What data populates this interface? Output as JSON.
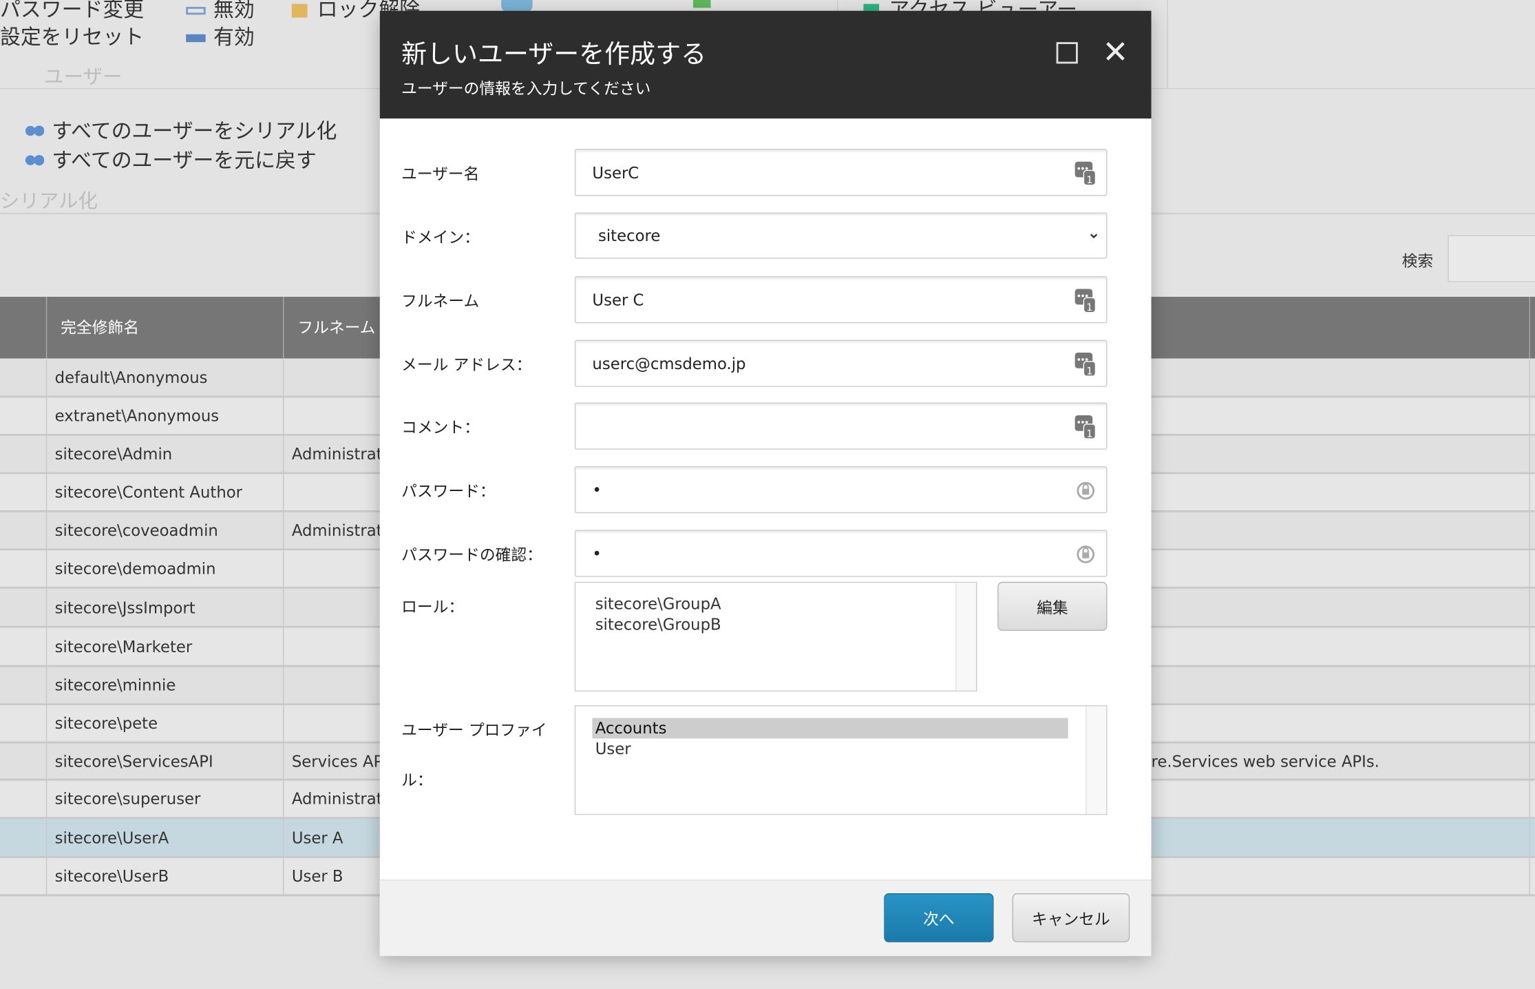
{
  "ribbon": {
    "change_password": "パスワード変更",
    "reset_settings": "設定をリセット",
    "disable": "無効",
    "enable": "有効",
    "unlock": "ロック解除",
    "access_viewer": "アクセス ビューアー",
    "group_users": "ユーザー",
    "serialize_all": "すべてのユーザーをシリアル化",
    "revert_all": "すべてのユーザーを元に戻す",
    "group_serialize": "シリアル化"
  },
  "search": {
    "label": "検索",
    "value": ""
  },
  "table": {
    "columns": [
      "完全修飾名",
      "フルネーム"
    ],
    "rows": [
      {
        "name": "default\\Anonymous",
        "fullname": "",
        "desc": ""
      },
      {
        "name": "extranet\\Anonymous",
        "fullname": "",
        "desc": ""
      },
      {
        "name": "sitecore\\Admin",
        "fullname": "Administrator",
        "desc": ""
      },
      {
        "name": "sitecore\\Content Author",
        "fullname": "",
        "desc": ""
      },
      {
        "name": "sitecore\\coveoadmin",
        "fullname": "Administrator",
        "desc": ""
      },
      {
        "name": "sitecore\\demoadmin",
        "fullname": "",
        "desc": ""
      },
      {
        "name": "sitecore\\JssImport",
        "fullname": "",
        "desc": ""
      },
      {
        "name": "sitecore\\Marketer",
        "fullname": "",
        "desc": ""
      },
      {
        "name": "sitecore\\minnie",
        "fullname": "",
        "desc": ""
      },
      {
        "name": "sitecore\\pete",
        "fullname": "",
        "desc": ""
      },
      {
        "name": "sitecore\\ServicesAPI",
        "fullname": "Services API",
        "desc": "re.Services web service APIs."
      },
      {
        "name": "sitecore\\superuser",
        "fullname": "Administrator",
        "desc": ""
      },
      {
        "name": "sitecore\\UserA",
        "fullname": "User A",
        "desc": "",
        "selected": true
      },
      {
        "name": "sitecore\\UserB",
        "fullname": "User B",
        "desc": ""
      }
    ]
  },
  "dialog": {
    "title": "新しいユーザーを作成する",
    "subtitle": "ユーザーの情報を入力してください",
    "fields": {
      "username": {
        "label": "ユーザー名",
        "value": "UserC"
      },
      "domain": {
        "label": "ドメイン：",
        "value": "sitecore"
      },
      "fullname": {
        "label": "フルネーム",
        "value": "User C"
      },
      "email": {
        "label": "メール アドレス：",
        "value": "userc@cmsdemo.jp"
      },
      "comment": {
        "label": "コメント：",
        "value": ""
      },
      "password": {
        "label": "パスワード：",
        "value": "•"
      },
      "confirm": {
        "label": "パスワードの確認：",
        "value": "•"
      },
      "roles": {
        "label": "ロール：",
        "items": [
          "sitecore\\GroupA",
          "sitecore\\GroupB"
        ],
        "edit_label": "編集"
      },
      "profile": {
        "label1": "ユーザー プロファイ",
        "label2": "ル：",
        "items": [
          "Accounts",
          "User"
        ],
        "selected": "Accounts"
      }
    },
    "next_label": "次へ",
    "cancel_label": "キャンセル"
  },
  "colors": {
    "header": "#2d2d2d",
    "primary": "#1f87b8",
    "table_header": "#767676",
    "selected_row": "#c5d8df"
  }
}
